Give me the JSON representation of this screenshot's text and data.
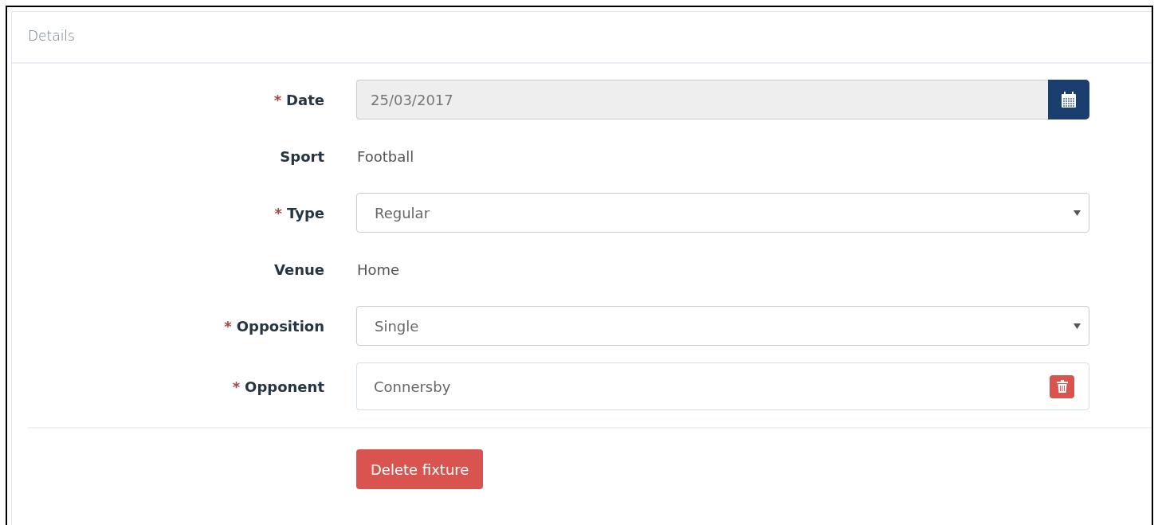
{
  "panel": {
    "title": "Details"
  },
  "fields": [
    {
      "kind": "date",
      "required_mark": "*",
      "label": "Date",
      "value": "25/03/2017"
    },
    {
      "kind": "static",
      "label": "Sport",
      "value": "Football"
    },
    {
      "kind": "select",
      "required_mark": "*",
      "label": "Type",
      "value": "Regular"
    },
    {
      "kind": "static",
      "label": "Venue",
      "value": "Home"
    },
    {
      "kind": "select",
      "required_mark": "*",
      "label": "Opposition",
      "value": "Single"
    },
    {
      "kind": "tag",
      "required_mark": "*",
      "label": "Opponent",
      "value": "Connersby"
    }
  ],
  "actions": [
    {
      "label": "Delete fixture"
    }
  ]
}
